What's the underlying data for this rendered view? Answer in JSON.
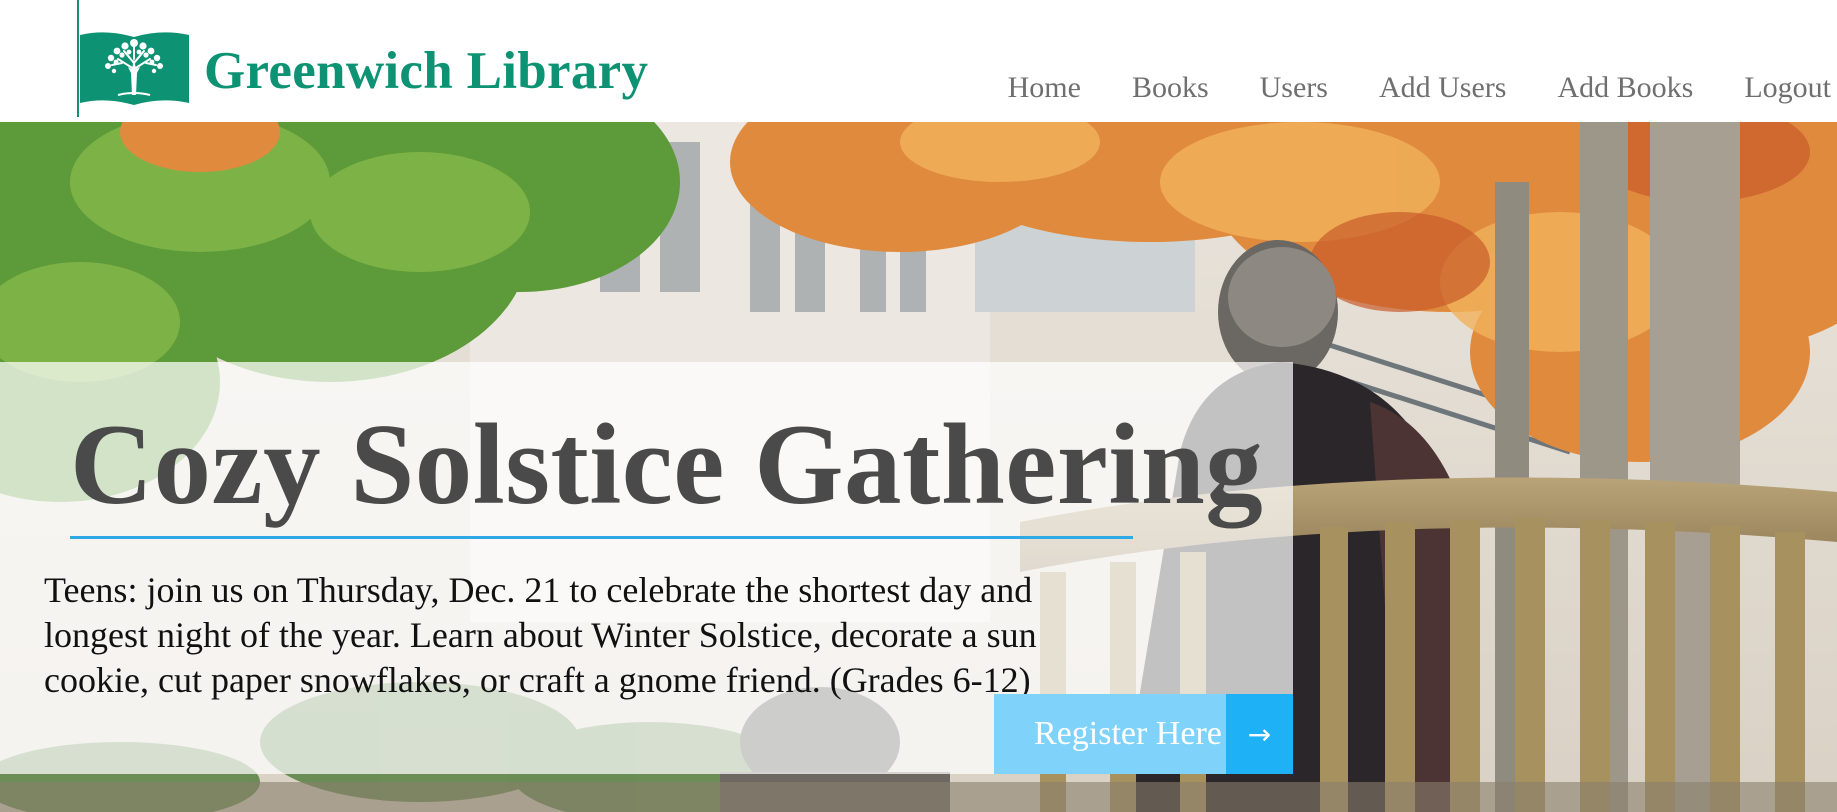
{
  "header": {
    "site_title": "Greenwich Library",
    "logo_icon": "open-book-tree-icon",
    "brand_color": "#0d9273"
  },
  "nav": {
    "items": [
      {
        "label": "Home"
      },
      {
        "label": "Books"
      },
      {
        "label": "Users"
      },
      {
        "label": "Add Users"
      },
      {
        "label": "Add Books"
      },
      {
        "label": "Logout"
      }
    ],
    "text_color": "#6f6f6f"
  },
  "hero": {
    "background": "autumn library courtyard photo",
    "title": "Cozy Solstice Gathering",
    "underline_color": "#2ea9e6",
    "description": "Teens: join us on Thursday, Dec. 21 to celebrate the shortest day and longest night of the year. Learn about Winter Solstice, decorate a sun cookie, cut paper snowflakes, or craft a gnome friend. (Grades 6-12)",
    "register_button": {
      "label": "Register Here",
      "arrow": "→",
      "arrow_icon": "arrow-right-icon",
      "color": "#7fd3fb",
      "arrow_bg": "#1fb1f5"
    }
  }
}
